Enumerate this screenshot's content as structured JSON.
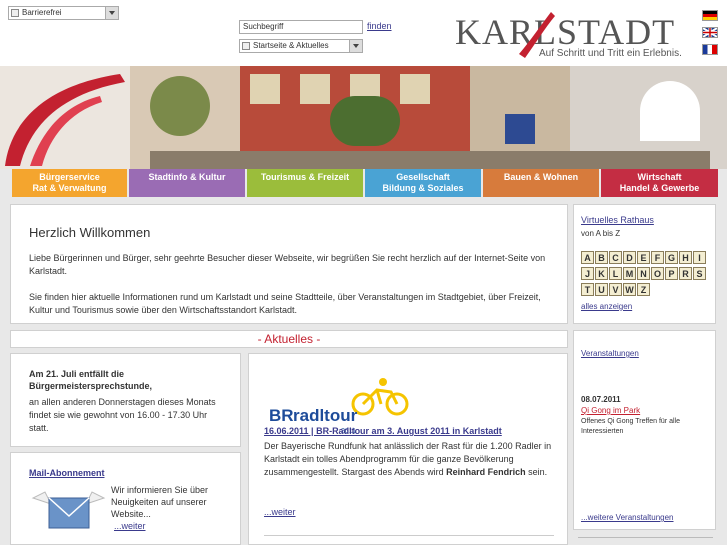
{
  "header": {
    "accessibility_select": "Barrierefrei",
    "search_placeholder": "Suchbegriff",
    "find_label": "finden",
    "nav_select": "Startseite & Aktuelles",
    "logo_text": "KARLSTADT",
    "logo_slogan": "Auf Schritt und Tritt ein Erlebnis."
  },
  "nav": [
    {
      "line1": "Bürgerservice",
      "line2": "Rat & Verwaltung",
      "color": "#f4a52e"
    },
    {
      "line1": "Stadtinfo & Kultur",
      "line2": "",
      "color": "#9a6cb4"
    },
    {
      "line1": "Tourismus & Freizeit",
      "line2": "",
      "color": "#9bbd3b"
    },
    {
      "line1": "Gesellschaft",
      "line2": "Bildung & Soziales",
      "color": "#4aa3d4"
    },
    {
      "line1": "Bauen & Wohnen",
      "line2": "",
      "color": "#d77b3c"
    },
    {
      "line1": "Wirtschaft",
      "line2": "Handel & Gewerbe",
      "color": "#c42d43"
    }
  ],
  "welcome": {
    "title": "Herzlich Willkommen",
    "p1": "Liebe Bürgerinnen und Bürger, sehr geehrte Besucher dieser Webseite, wir begrüßen Sie recht herzlich auf der Internet-Seite von Karlstadt.",
    "p2": "Sie finden hier aktuelle Informationen rund um Karlstadt und seine Stadtteile, über Veranstaltungen im Stadtgebiet, über Freizeit, Kultur und Tourismus sowie über den Wirtschaftsstandort Karlstadt."
  },
  "rathaus": {
    "title": "Virtuelles Rathaus",
    "subtitle": "von A bis Z",
    "letters": [
      "A",
      "B",
      "C",
      "D",
      "E",
      "F",
      "G",
      "H",
      "I",
      "J",
      "K",
      "L",
      "M",
      "N",
      "O",
      "P",
      "R",
      "S",
      "T",
      "U",
      "V",
      "W",
      "Z"
    ],
    "all_link": "alles anzeigen"
  },
  "aktuelles_heading": "- Aktuelles -",
  "notice": {
    "title": "Am 21. Juli entfällt die Bürgermeistersprechstunde,",
    "text": "an allen anderen Donnerstagen dieses Monats findet sie wie gewohnt von 16.00 - 17.30 Uhr statt."
  },
  "mail": {
    "title": "Mail-Abonnement",
    "text": "Wir informieren Sie über Neuigkeiten auf unserer Website...",
    "more": "...weiter"
  },
  "news": {
    "logo_br": "BR",
    "logo_name": "radltour",
    "logo_year": "2011",
    "headline": "16.06.2011 | BR-Radltour am 3. August 2011 in Karlstadt",
    "text_a": "Der Bayerische Rundfunk hat anlässlich der Rast für die 1.200 Radler in Karlstadt ein tolles Abendprogramm für die ganze Bevölkerung zusammengestellt. Stargast des Abends wird ",
    "text_bold": "Reinhard Fendrich",
    "text_b": " sein.",
    "more": "...weiter"
  },
  "events": {
    "title": "Veranstaltungen",
    "date": "08.07.2011",
    "event_title": "Qi Gong im Park",
    "event_text": "Offenes Qi Gong Treffen für alle Interessierten",
    "more": "...weitere Veranstaltungen"
  },
  "colors": {
    "accent_red": "#c32130",
    "link": "#3a3a8c"
  }
}
